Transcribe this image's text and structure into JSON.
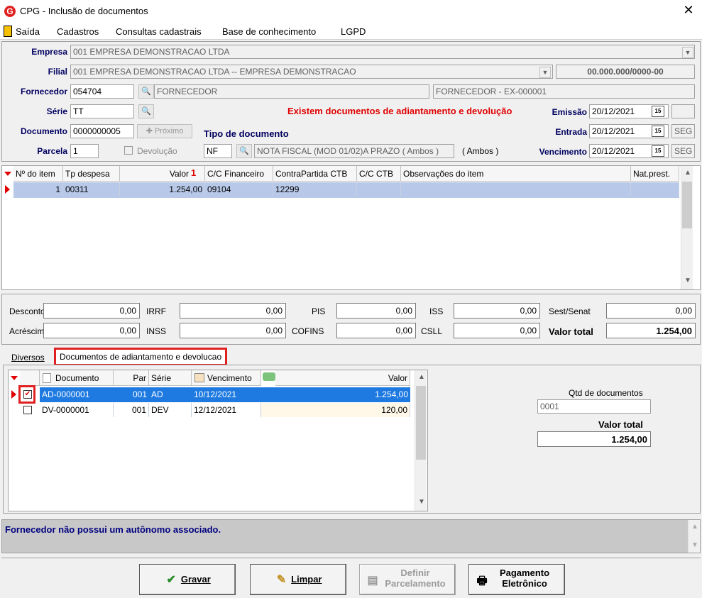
{
  "window": {
    "title": "CPG - Inclusão de documentos",
    "close": "✕",
    "app_icon": "G"
  },
  "menu": [
    "Saída",
    "Cadastros",
    "Consultas cadastrais",
    "Base de conhecimento",
    "LGPD"
  ],
  "header": {
    "empresa_label": "Empresa",
    "empresa_value": "001 EMPRESA DEMONSTRACAO LTDA",
    "filial_label": "Filial",
    "filial_value": "001 EMPRESA DEMONSTRACAO LTDA -- EMPRESA DEMONSTRACAO",
    "cnpj": "00.000.000/0000-00",
    "fornecedor_label": "Fornecedor",
    "fornecedor_code": "054704",
    "fornecedor_name": "FORNECEDOR",
    "fornecedor_desc": "FORNECEDOR - EX-000001",
    "serie_label": "Série",
    "serie_value": "TT",
    "warning": "Existem documentos de adiantamento e devolução",
    "emissao_label": "Emissão",
    "emissao_value": "20/12/2021",
    "documento_label": "Documento",
    "documento_value": "0000000005",
    "proximo_label": "Próximo",
    "tipo_label": "Tipo de documento",
    "entrada_label": "Entrada",
    "entrada_value": "20/12/2021",
    "entrada_day": "SEG",
    "parcela_label": "Parcela",
    "parcela_value": "1",
    "devolucao_label": "Devolução",
    "tipo_code": "NF",
    "tipo_desc": "NOTA FISCAL (MOD 01/02)A PRAZO ( Ambos )",
    "tipo_extra": "( Ambos )",
    "vencimento_label": "Vencimento",
    "vencimento_value": "20/12/2021",
    "vencimento_day": "SEG"
  },
  "items_grid": {
    "columns": [
      "Nº do item",
      "Tp despesa",
      "Valor",
      "C/C Financeiro",
      "ContraPartida CTB",
      "C/C CTB",
      "Observações do item",
      "Nat.prest."
    ],
    "rows": [
      [
        "1",
        "00311",
        "1.254,00",
        "09104",
        "12299",
        "",
        "",
        ""
      ]
    ]
  },
  "totals": {
    "desconto_label": "Desconto",
    "desconto": "0,00",
    "irrf_label": "IRRF",
    "irrf": "0,00",
    "pis_label": "PIS",
    "pis": "0,00",
    "iss_label": "ISS",
    "iss": "0,00",
    "sest_label": "Sest/Senat",
    "sest": "0,00",
    "acrescimo_label": "Acréscimo",
    "acrescimo": "0,00",
    "inss_label": "INSS",
    "inss": "0,00",
    "cofins_label": "COFINS",
    "cofins": "0,00",
    "csll_label": "CSLL",
    "csll": "0,00",
    "valor_total_label": "Valor total",
    "valor_total": "1.254,00"
  },
  "tabs": [
    "Diversos",
    "Documentos de adiantamento e devolucao"
  ],
  "adv_grid": {
    "columns": [
      "Documento",
      "Par",
      "Série",
      "Vencimento",
      "Valor"
    ],
    "rows": [
      {
        "checked": true,
        "doc": "AD-0000001",
        "par": "001",
        "serie": "AD",
        "venc": "10/12/2021",
        "valor": "1.254,00"
      },
      {
        "checked": false,
        "doc": "DV-0000001",
        "par": "001",
        "serie": "DEV",
        "venc": "12/12/2021",
        "valor": "120,00"
      }
    ],
    "qtd_label": "Qtd de documentos",
    "qtd_value": "0001",
    "valor_total_label": "Valor total",
    "valor_total": "1.254,00"
  },
  "status": {
    "message": "Fornecedor não possui um autônomo associado."
  },
  "buttons": {
    "gravar": "Gravar",
    "limpar": "Limpar",
    "definir1": "Definir",
    "definir2": "Parcelamento",
    "pagamento1": "Pagamento",
    "pagamento2": "Eletrônico"
  }
}
